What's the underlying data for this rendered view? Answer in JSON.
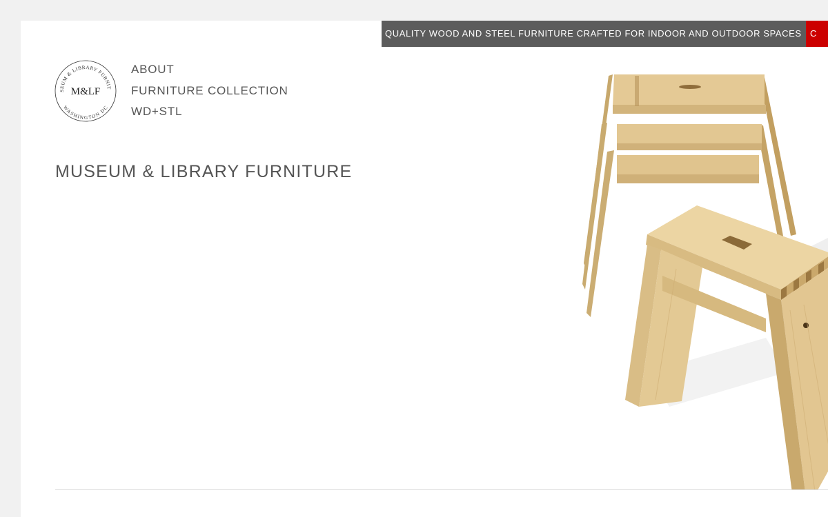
{
  "header": {
    "tagline": "QUALITY WOOD AND STEEL FURNITURE CRAFTED FOR INDOOR AND OUTDOOR SPACES",
    "contact_label": "C"
  },
  "logo": {
    "monogram": "M&LF",
    "ring_text_top": "MUSEUM & LIBRARY FURNITURE",
    "ring_text_bottom": "WASHINGTON DC"
  },
  "nav": {
    "items": [
      {
        "label": "ABOUT"
      },
      {
        "label": "FURNITURE COLLECTION"
      },
      {
        "label": "WD+STL"
      }
    ]
  },
  "main": {
    "title": "MUSEUM & LIBRARY FURNITURE"
  },
  "colors": {
    "tagline_bg": "#5c5c5c",
    "accent_red": "#cc0000",
    "text_gray": "#555555",
    "wood_light": "#e9d3a0",
    "wood_mid": "#d9bc82",
    "wood_dark": "#a8844c"
  }
}
